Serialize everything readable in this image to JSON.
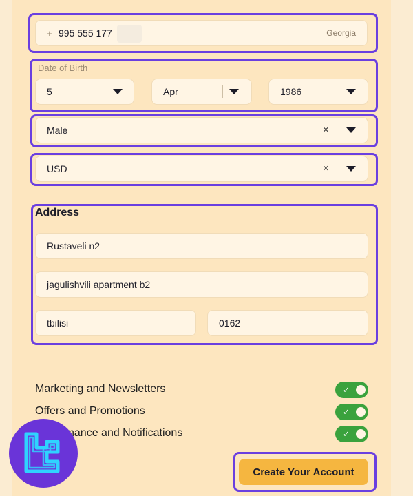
{
  "phone": {
    "prefix": "+",
    "number": "995 555 177",
    "country": "Georgia"
  },
  "dob": {
    "label": "Date of Birth",
    "day": "5",
    "month": "Apr",
    "year": "1986"
  },
  "gender": {
    "value": "Male"
  },
  "currency": {
    "value": "USD"
  },
  "address": {
    "title": "Address",
    "line1": "Rustaveli n2",
    "line2": "jagulishvili apartment b2",
    "city": "tbilisi",
    "postal": "0162"
  },
  "preferences": [
    {
      "label": "Marketing and Newsletters",
      "on": true
    },
    {
      "label": "Offers and Promotions",
      "on": true
    },
    {
      "label": "Performance and Notifications",
      "on": true
    }
  ],
  "submit_label": "Create Your Account",
  "icons": {
    "clear": "×",
    "check": "✓"
  },
  "colors": {
    "highlight": "#6a3fe0",
    "toggle_on": "#3aa23d",
    "button": "#f5b640",
    "logo_bg": "#6a34d8",
    "logo_stroke": "#2fd3ff"
  }
}
